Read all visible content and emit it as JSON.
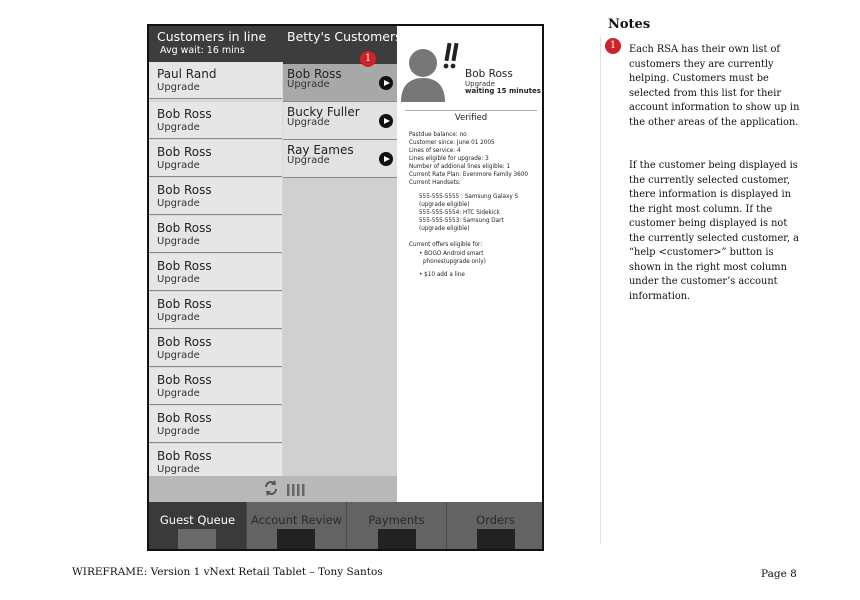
{
  "queue": {
    "title": "Customers in line",
    "subtitle": "Avg wait: 16 mins",
    "items": [
      {
        "name": "Paul Rand",
        "status": "Upgrade"
      },
      {
        "name": "Bob Ross",
        "status": "Upgrade"
      },
      {
        "name": "Bob Ross",
        "status": "Upgrade"
      },
      {
        "name": "Bob Ross",
        "status": "Upgrade"
      },
      {
        "name": "Bob Ross",
        "status": "Upgrade"
      },
      {
        "name": "Bob Ross",
        "status": "Upgrade"
      },
      {
        "name": "Bob Ross",
        "status": "Upgrade"
      },
      {
        "name": "Bob Ross",
        "status": "Upgrade"
      },
      {
        "name": "Bob Ross",
        "status": "Upgrade"
      },
      {
        "name": "Bob Ross",
        "status": "Upgrade"
      },
      {
        "name": "Bob Ross",
        "status": "Upgrade"
      }
    ],
    "refresh_icon": "refresh-icon",
    "grip_icon": "grip-icon"
  },
  "betty": {
    "title": "Betty's Customers",
    "badge": "1",
    "items": [
      {
        "name": "Bob Ross",
        "status": "Upgrade",
        "selected": true
      },
      {
        "name": "Bucky Fuller",
        "status": "Upgrade",
        "selected": false
      },
      {
        "name": "Ray Eames",
        "status": "Upgrade",
        "selected": false
      }
    ],
    "item_icon": "play-icon"
  },
  "detail": {
    "avatar_icon": "person-alert-icon",
    "name": "Bob Ross",
    "status": "Upgrade",
    "wait": "waiting 15 minutes",
    "verified": "Verified",
    "lines": [
      "Pastdue balance: no",
      "Customer since: June 01 2005",
      "Lines of service: 4",
      "Lines eligible for upgrade: 3",
      "Number of addional lines eligible: 1",
      "Current Rate Plan: Evenmore Family 3600",
      "Current Handsets:"
    ],
    "handsets": [
      "555-555-5555 : Samsung Galaxy S",
      "(upgrade eligible)",
      "555-555-5554: HTC Sidekick",
      "555-555-5553: Samsung Dart",
      "(upgrade eligible)"
    ],
    "offers_title": "Current offers eligible for:",
    "offers": [
      "• BOGO Android smart",
      "phones(upgrade only)",
      "• $10 add a line"
    ]
  },
  "nav": {
    "tabs": [
      {
        "label": "Guest Queue",
        "active": true
      },
      {
        "label": "Account Review",
        "active": false
      },
      {
        "label": "Payments",
        "active": false
      },
      {
        "label": "Orders",
        "active": false
      }
    ]
  },
  "notes": {
    "title": "Notes",
    "badge": "1",
    "p1": "Each RSA has their own list of customers they are currently helping. Customers must be selected from this list for their account information to show up in the other areas of the application.",
    "p2": "If the customer being displayed is the currently selected customer, there information is displayed in the right most column. If the customer being displayed is not the currently selected customer, a “help <customer>” button is shown in the right most column under the customer’s account information."
  },
  "footer": {
    "left": "WIREFRAME: Version 1 vNext Retail Tablet – Tony Santos",
    "right": "Page 8"
  },
  "colors": {
    "header_dark": "#3d3d3d",
    "nav_bar": "#636363",
    "badge_red": "#d0202a"
  }
}
